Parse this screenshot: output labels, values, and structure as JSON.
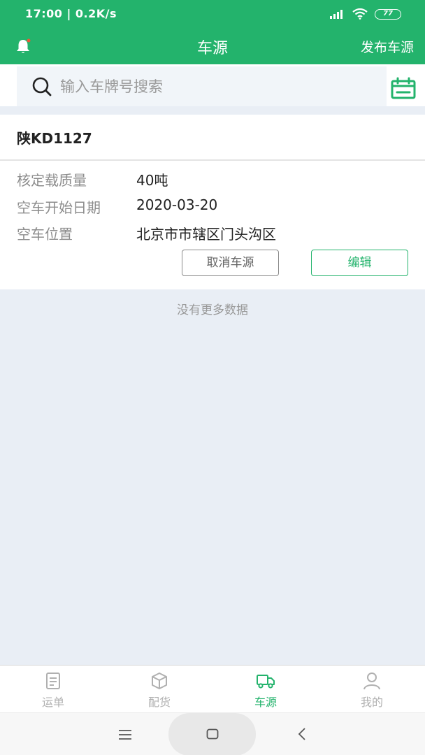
{
  "status_bar": {
    "time": "17:00 | 0.2K/s",
    "battery": "77"
  },
  "header": {
    "title": "车源",
    "action": "发布车源"
  },
  "search": {
    "placeholder": "输入车牌号搜索",
    "value": ""
  },
  "vehicle": {
    "plate": "陕KD1127",
    "fields": [
      {
        "label": "核定载质量",
        "value": "40吨"
      },
      {
        "label": "空车开始日期",
        "value": "2020-03-20"
      },
      {
        "label": "空车位置",
        "value": "北京市市辖区门头沟区"
      }
    ],
    "cancel_label": "取消车源",
    "edit_label": "编辑"
  },
  "list_end_text": "没有更多数据",
  "tabs": [
    {
      "label": "运单",
      "icon": "waybill-icon",
      "active": false
    },
    {
      "label": "配货",
      "icon": "package-icon",
      "active": false
    },
    {
      "label": "车源",
      "icon": "truck-icon",
      "active": true
    },
    {
      "label": "我的",
      "icon": "person-icon",
      "active": false
    }
  ],
  "colors": {
    "brand": "#23b36c",
    "background": "#e9eef5",
    "inactive": "#b0b0b0"
  }
}
